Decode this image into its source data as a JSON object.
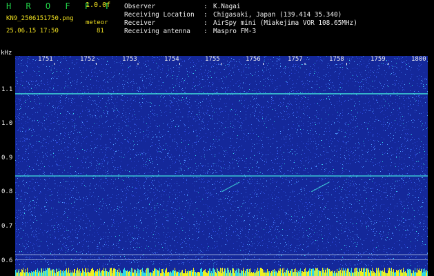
{
  "header": {
    "brand": "H R O F F T",
    "version": "1.0.0f",
    "filename": "KN9_2506151750.png",
    "datetime": "25.06.15 17:50",
    "meteor_label": "meteor",
    "meteor_count": "81"
  },
  "info": [
    {
      "key": "Observer",
      "value": "K.Nagai"
    },
    {
      "key": "Receiving Location",
      "value": "Chigasaki, Japan (139.414 35.340)"
    },
    {
      "key": "Receiver",
      "value": "AirSpy mini (Miakejima VOR 108.65MHz)"
    },
    {
      "key": "Receiving antenna",
      "value": "Maspro FM-3"
    }
  ],
  "axis": {
    "y_unit": "kHz",
    "y_ticks": [
      "1.1",
      "1.0",
      "0.9",
      "0.8",
      "0.7",
      "0.6"
    ],
    "x_ticks": [
      "1751",
      "1752",
      "1753",
      "1754",
      "1755",
      "1756",
      "1757",
      "1758",
      "1759",
      "1800"
    ]
  },
  "spectrogram": {
    "background_color": "#14289a",
    "noise_colors": [
      "#2a46d8",
      "#3a6ae8",
      "#4fa0ff",
      "#30d8e8"
    ],
    "carrier_color": "#3fd8d8",
    "carrier_lines_khz": [
      1.09,
      0.85
    ],
    "reference_lines_khz": [
      0.62,
      0.605
    ],
    "meteor_traces": [
      {
        "time_min": 1755.45,
        "khz": 0.82
      },
      {
        "time_min": 1757.6,
        "khz": 0.82
      }
    ]
  }
}
